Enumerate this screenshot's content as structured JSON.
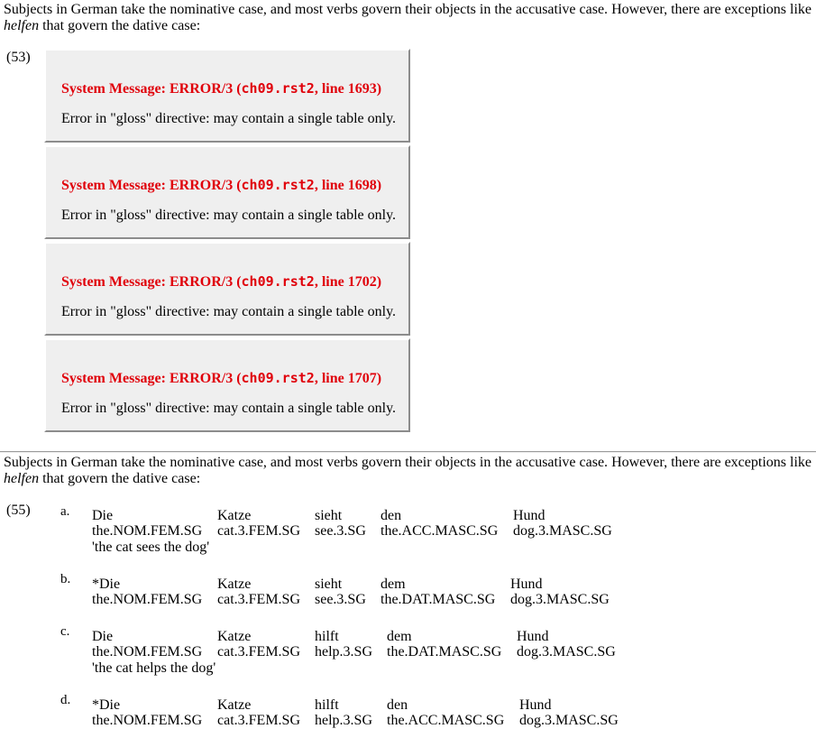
{
  "intro_before_em": "Subjects in German take the nominative case, and most verbs govern their objects in the accusative case. However, there are exceptions like",
  "intro_em": "helfen",
  "intro_after_em": "that govern the dative case:",
  "example_53": {
    "number": "(53)",
    "messages": [
      {
        "prefix": "System Message: ERROR/3 (",
        "file": "ch09.rst2",
        "suffix": ", line 1693)",
        "body": "Error in \"gloss\" directive: may contain a single table only."
      },
      {
        "prefix": "System Message: ERROR/3 (",
        "file": "ch09.rst2",
        "suffix": ", line 1698)",
        "body": "Error in \"gloss\" directive: may contain a single table only."
      },
      {
        "prefix": "System Message: ERROR/3 (",
        "file": "ch09.rst2",
        "suffix": ", line 1702)",
        "body": "Error in \"gloss\" directive: may contain a single table only."
      },
      {
        "prefix": "System Message: ERROR/3 (",
        "file": "ch09.rst2",
        "suffix": ", line 1707)",
        "body": "Error in \"gloss\" directive: may contain a single table only."
      }
    ]
  },
  "example_55": {
    "number": "(55)",
    "items": [
      {
        "label": "a.",
        "words": [
          "Die",
          "Katze",
          "sieht",
          "den",
          "Hund"
        ],
        "glosses": [
          "the.NOM.FEM.SG",
          "cat.3.FEM.SG",
          "see.3.SG",
          "the.ACC.MASC.SG",
          "dog.3.MASC.SG"
        ],
        "translation": "'the cat sees the dog'"
      },
      {
        "label": "b.",
        "words": [
          "*Die",
          "Katze",
          "sieht",
          "dem",
          "Hund"
        ],
        "glosses": [
          "the.NOM.FEM.SG",
          "cat.3.FEM.SG",
          "see.3.SG",
          "the.DAT.MASC.SG",
          "dog.3.MASC.SG"
        ],
        "translation": ""
      },
      {
        "label": "c.",
        "words": [
          "Die",
          "Katze",
          "hilft",
          "dem",
          "Hund"
        ],
        "glosses": [
          "the.NOM.FEM.SG",
          "cat.3.FEM.SG",
          "help.3.SG",
          "the.DAT.MASC.SG",
          "dog.3.MASC.SG"
        ],
        "translation": "'the cat helps the dog'"
      },
      {
        "label": "d.",
        "words": [
          "*Die",
          "Katze",
          "hilft",
          "den",
          "Hund"
        ],
        "glosses": [
          "the.NOM.FEM.SG",
          "cat.3.FEM.SG",
          "help.3.SG",
          "the.ACC.MASC.SG",
          "dog.3.MASC.SG"
        ],
        "translation": ""
      }
    ]
  },
  "colors": {
    "error_red": "#e0000a",
    "box_bg": "#efefef"
  }
}
